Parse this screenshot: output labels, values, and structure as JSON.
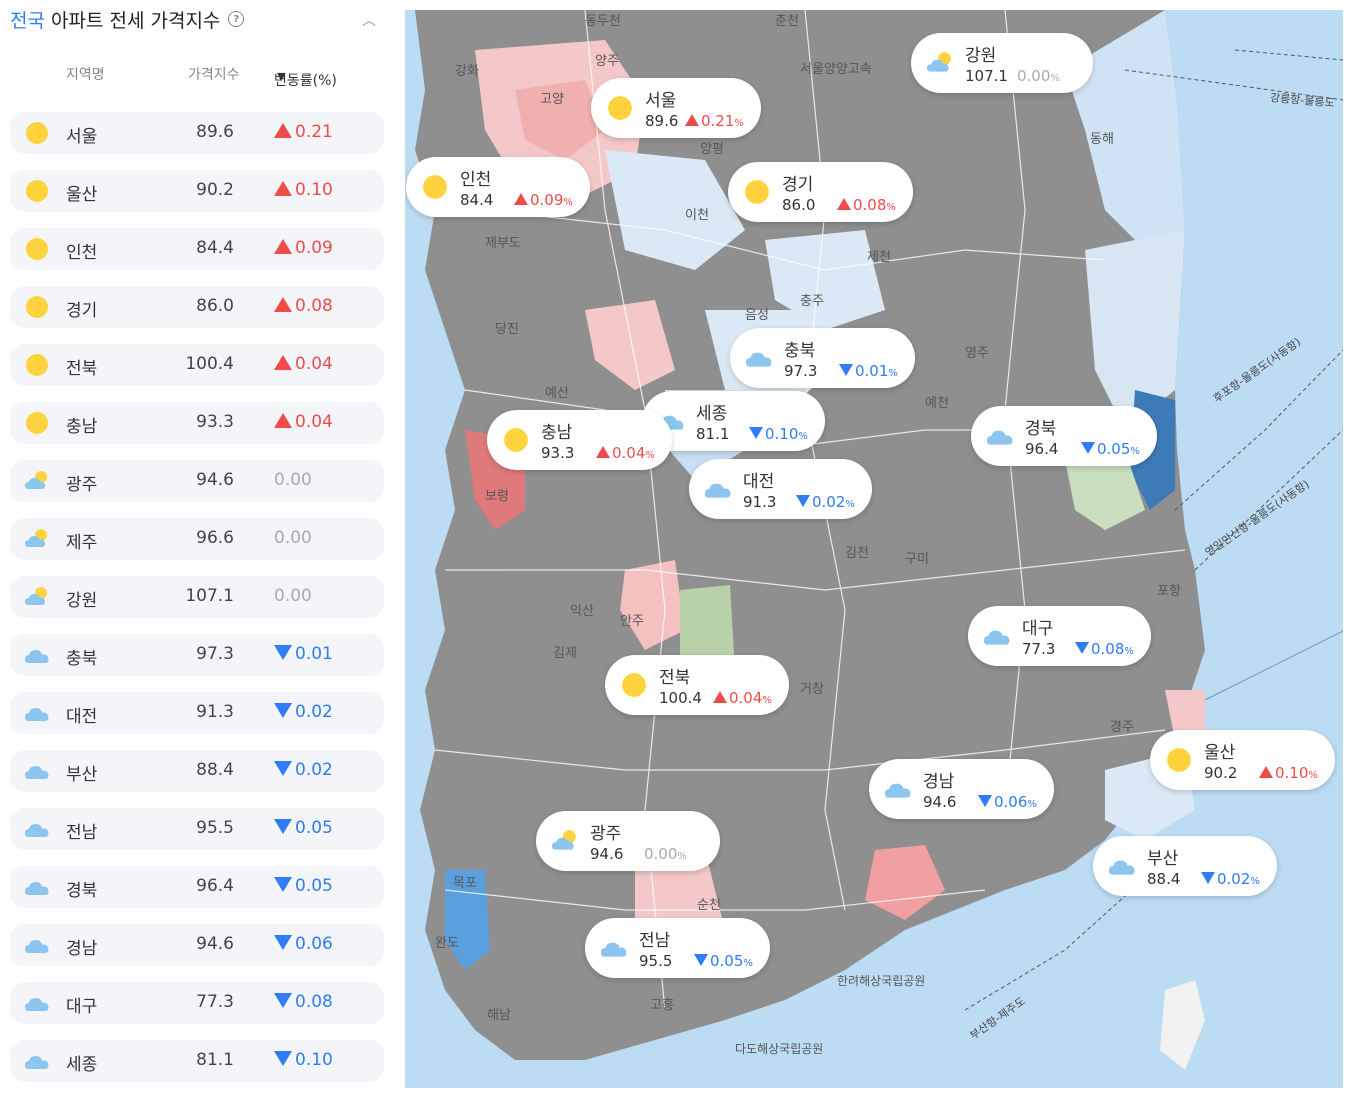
{
  "header": {
    "title_accent": "전국",
    "title_rest": " 아파트 전세 가격지수",
    "help_icon": "?",
    "collapse_icon": "chevron-up"
  },
  "columns": {
    "name": "지역명",
    "index": "가격지수",
    "change": "변동률(%)",
    "sort_icon": "▼"
  },
  "colors": {
    "up": "#ef4b4b",
    "down": "#2f7cf6",
    "flat": "#aaaaaa",
    "sun": "#ffd33d",
    "cloud": "#8cc5f0"
  },
  "regions": [
    {
      "name": "서울",
      "index": "89.6",
      "change": "0.21",
      "direction": "up",
      "weather": "sunny"
    },
    {
      "name": "울산",
      "index": "90.2",
      "change": "0.10",
      "direction": "up",
      "weather": "sunny"
    },
    {
      "name": "인천",
      "index": "84.4",
      "change": "0.09",
      "direction": "up",
      "weather": "sunny"
    },
    {
      "name": "경기",
      "index": "86.0",
      "change": "0.08",
      "direction": "up",
      "weather": "sunny"
    },
    {
      "name": "전북",
      "index": "100.4",
      "change": "0.04",
      "direction": "up",
      "weather": "sunny"
    },
    {
      "name": "충남",
      "index": "93.3",
      "change": "0.04",
      "direction": "up",
      "weather": "sunny"
    },
    {
      "name": "광주",
      "index": "94.6",
      "change": "0.00",
      "direction": "flat",
      "weather": "partly-cloudy"
    },
    {
      "name": "제주",
      "index": "96.6",
      "change": "0.00",
      "direction": "flat",
      "weather": "partly-cloudy"
    },
    {
      "name": "강원",
      "index": "107.1",
      "change": "0.00",
      "direction": "flat",
      "weather": "partly-cloudy"
    },
    {
      "name": "충북",
      "index": "97.3",
      "change": "0.01",
      "direction": "down",
      "weather": "cloudy"
    },
    {
      "name": "대전",
      "index": "91.3",
      "change": "0.02",
      "direction": "down",
      "weather": "cloudy"
    },
    {
      "name": "부산",
      "index": "88.4",
      "change": "0.02",
      "direction": "down",
      "weather": "cloudy"
    },
    {
      "name": "전남",
      "index": "95.5",
      "change": "0.05",
      "direction": "down",
      "weather": "cloudy"
    },
    {
      "name": "경북",
      "index": "96.4",
      "change": "0.05",
      "direction": "down",
      "weather": "cloudy"
    },
    {
      "name": "경남",
      "index": "94.6",
      "change": "0.06",
      "direction": "down",
      "weather": "cloudy"
    },
    {
      "name": "대구",
      "index": "77.3",
      "change": "0.08",
      "direction": "down",
      "weather": "cloudy"
    },
    {
      "name": "세종",
      "index": "81.1",
      "change": "0.10",
      "direction": "down",
      "weather": "cloudy"
    }
  ],
  "map_callouts": [
    {
      "name": "서울",
      "index": "89.6",
      "change": "0.21",
      "direction": "up",
      "weather": "sunny"
    },
    {
      "name": "인천",
      "index": "84.4",
      "change": "0.09",
      "direction": "up",
      "weather": "sunny"
    },
    {
      "name": "경기",
      "index": "86.0",
      "change": "0.08",
      "direction": "up",
      "weather": "sunny"
    },
    {
      "name": "강원",
      "index": "107.1",
      "change": "0.00",
      "direction": "flat",
      "weather": "partly-cloudy"
    },
    {
      "name": "충북",
      "index": "97.3",
      "change": "0.01",
      "direction": "down",
      "weather": "cloudy"
    },
    {
      "name": "세종",
      "index": "81.1",
      "change": "0.10",
      "direction": "down",
      "weather": "cloudy"
    },
    {
      "name": "충남",
      "index": "93.3",
      "change": "0.04",
      "direction": "up",
      "weather": "sunny"
    },
    {
      "name": "대전",
      "index": "91.3",
      "change": "0.02",
      "direction": "down",
      "weather": "cloudy"
    },
    {
      "name": "경북",
      "index": "96.4",
      "change": "0.05",
      "direction": "down",
      "weather": "cloudy"
    },
    {
      "name": "대구",
      "index": "77.3",
      "change": "0.08",
      "direction": "down",
      "weather": "cloudy"
    },
    {
      "name": "전북",
      "index": "100.4",
      "change": "0.04",
      "direction": "up",
      "weather": "sunny"
    },
    {
      "name": "울산",
      "index": "90.2",
      "change": "0.10",
      "direction": "up",
      "weather": "sunny"
    },
    {
      "name": "경남",
      "index": "94.6",
      "change": "0.06",
      "direction": "down",
      "weather": "cloudy"
    },
    {
      "name": "광주",
      "index": "94.6",
      "change": "0.00",
      "direction": "flat",
      "weather": "partly-cloudy"
    },
    {
      "name": "부산",
      "index": "88.4",
      "change": "0.02",
      "direction": "down",
      "weather": "cloudy"
    },
    {
      "name": "전남",
      "index": "95.5",
      "change": "0.05",
      "direction": "down",
      "weather": "cloudy"
    }
  ],
  "map_labels": [
    "춘천",
    "동두천",
    "양주",
    "강화",
    "고양",
    "양평",
    "이천",
    "제천",
    "충주",
    "음성",
    "당진",
    "예산",
    "보령",
    "익산",
    "김제",
    "안주",
    "김천",
    "구미",
    "포항",
    "영주",
    "예천",
    "동해",
    "거창",
    "순천",
    "고흥",
    "해남",
    "목포",
    "완도",
    "제부도",
    "경주",
    "다도해상국립공원",
    "한려해상국립공원",
    "후포항-울릉도(사동항)",
    "영일만신항-울릉도(사동항)",
    "강릉항-울릉도",
    "부산항-제주도",
    "서울양양고속"
  ],
  "unit_suffix": "%"
}
